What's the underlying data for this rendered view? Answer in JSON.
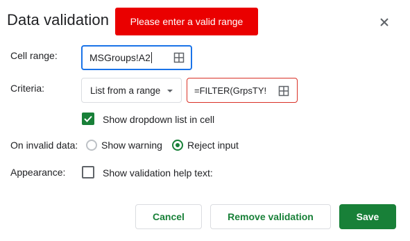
{
  "dialog": {
    "title": "Data validation",
    "error_message": "Please enter a valid range"
  },
  "cell_range": {
    "label": "Cell range:",
    "value": "MSGroups!A2"
  },
  "criteria": {
    "label": "Criteria:",
    "type_selected": "List from a range",
    "formula_value": "=FILTER(GrpsTY!",
    "show_dropdown_label": "Show dropdown list in cell",
    "show_dropdown_checked": true
  },
  "invalid_data": {
    "label": "On invalid data:",
    "option_warning": "Show warning",
    "option_reject": "Reject input",
    "selected": "reject"
  },
  "appearance": {
    "label": "Appearance:",
    "help_text_label": "Show validation help text:",
    "help_text_checked": false
  },
  "buttons": {
    "cancel": "Cancel",
    "remove": "Remove validation",
    "save": "Save"
  },
  "colors": {
    "accent_green": "#188038",
    "error_red": "#ea0000",
    "focus_blue": "#1a73e8"
  }
}
